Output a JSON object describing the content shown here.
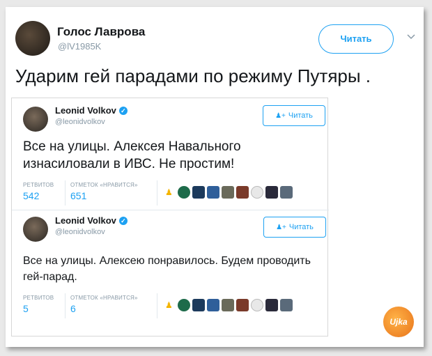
{
  "tweet": {
    "author_name": "Голос Лаврова",
    "author_handle": "@lV1985K",
    "follow_label": "Читать",
    "text": "Ударим гей парадами по режиму Путяры ."
  },
  "quotes": [
    {
      "name": "Leonid Volkov",
      "handle": "@leonidvolkov",
      "follow_label": "Читать",
      "text": "Все на улицы. Алексея Навального изнасиловали в ИВС. Не простим!",
      "retweets_label": "РЕТВИТОВ",
      "retweets": "542",
      "likes_label": "ОТМЕТОК «НРАВИТСЯ»",
      "likes": "651"
    },
    {
      "name": "Leonid Volkov",
      "handle": "@leonidvolkov",
      "follow_label": "Читать",
      "text": "Все на улицы. Алексею понравилось. Будем проводить гей-парад.",
      "retweets_label": "РЕТВИТОВ",
      "retweets": "5",
      "likes_label": "ОТМЕТОК «НРАВИТСЯ»",
      "likes": "6"
    }
  ],
  "colors": {
    "accent": "#1da1f2",
    "text": "#14171a",
    "muted": "#8899a6"
  },
  "icons": {
    "verified": "verified-badge-icon",
    "chevron": "chevron-down-icon",
    "person_add": "person-add-icon",
    "stamp": "watermark-stamp"
  },
  "watermark_text": "Ujka"
}
